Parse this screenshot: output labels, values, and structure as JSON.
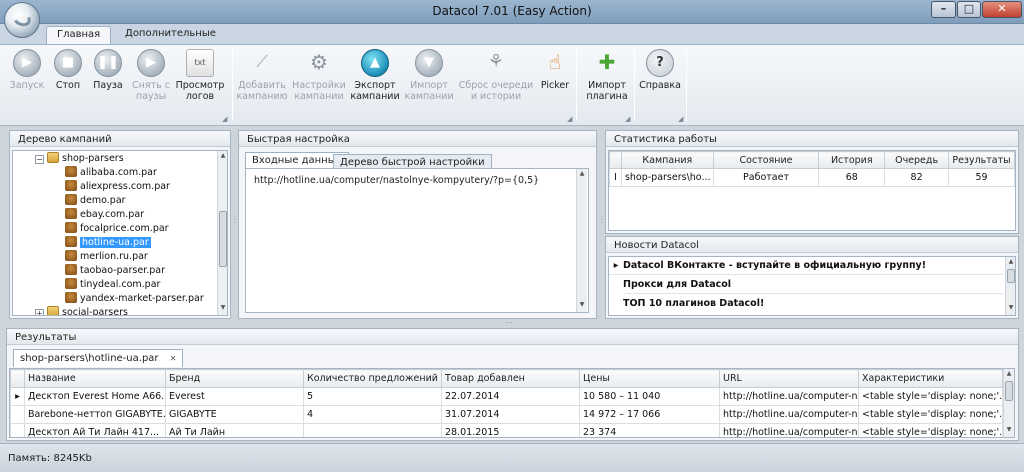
{
  "window": {
    "title": "Datacol 7.01 (Easy Action)",
    "min": "–",
    "max": "□",
    "close": "✕"
  },
  "ribbon": {
    "tabs": [
      "Главная",
      "Дополнительные"
    ],
    "buttons": {
      "start": [
        "Запуск",
        ""
      ],
      "stop": [
        "Стоп",
        ""
      ],
      "pause": [
        "Пауза",
        ""
      ],
      "unpause": [
        "Снять с",
        "паузы"
      ],
      "logs": [
        "Просмотр",
        "логов"
      ],
      "add_campaign": [
        "Добавить",
        "кампанию"
      ],
      "campaign_settings": [
        "Настройки",
        "кампании"
      ],
      "export_campaigns": [
        "Экспорт",
        "кампании"
      ],
      "import_campaigns": [
        "Импорт",
        "кампании"
      ],
      "reset_queue": [
        "Сброс очереди",
        "и истории"
      ],
      "picker": [
        "Picker",
        ""
      ],
      "import_plugin": [
        "Импорт",
        "плагина"
      ],
      "help": [
        "Справка",
        ""
      ]
    }
  },
  "tree_panel": {
    "title": "Дерево кампаний",
    "root": "shop-parsers",
    "items": [
      "alibaba.com.par",
      "aliexpress.com.par",
      "demo.par",
      "ebay.com.par",
      "focalprice.com.par",
      "hotline-ua.par",
      "merlion.ru.par",
      "taobao-parser.par",
      "tinydeal.com.par",
      "yandex-market-parser.par"
    ],
    "selected": "hotline-ua.par",
    "next_folder": "social-parsers",
    "expand_minus": "−",
    "expand_plus": "+"
  },
  "quick_settings": {
    "title": "Быстрая настройка",
    "tabs": [
      "Входные данные",
      "Дерево быстрой настройки"
    ],
    "input_value": "http://hotline.ua/computer/nastolnye-kompyutery/?p={0,5}"
  },
  "stats": {
    "title": "Статистика работы",
    "columns": [
      "Кампания",
      "Состояние",
      "История",
      "Очередь",
      "Результаты"
    ],
    "row": {
      "marker": "I",
      "campaign": "shop-parsers\\ho...",
      "state": "Работает",
      "history": "68",
      "queue": "82",
      "results": "59"
    }
  },
  "news": {
    "title": "Новости Datacol",
    "marker": "▸",
    "items": [
      "Datacol ВКонтакте - вступайте в официальную группу!",
      "Прокси для Datacol",
      "ТОП 10 плагинов Datacol!"
    ]
  },
  "results": {
    "title": "Результаты",
    "tab_label": "shop-parsers\\hotline-ua.par",
    "tab_close": "✕",
    "columns": [
      "Название",
      "Бренд",
      "Количество предложений",
      "Товар добавлен",
      "Цены",
      "URL",
      "Характеристики"
    ],
    "rows": [
      {
        "marker": "▸",
        "name": "Десктоп Everest Home A66...",
        "brand": "Everest",
        "offers": "5",
        "added": "22.07.2014",
        "prices": "10 580 – 11 040",
        "url": "http://hotline.ua/computer-n...",
        "specs": "<table style='display: none;'..."
      },
      {
        "marker": "",
        "name": "Barebone-неттоп GIGABYTE...",
        "brand": "GIGABYTE",
        "offers": "4",
        "added": "31.07.2014",
        "prices": "14 972 – 17 066",
        "url": "http://hotline.ua/computer-n...",
        "specs": "<table style='display: none;'..."
      },
      {
        "marker": "",
        "name": "Десктоп Ай Ти Лайн 417...",
        "brand": "Ай Ти Лайн",
        "offers": "",
        "added": "28.01.2015",
        "prices": "23 374",
        "url": "http://hotline.ua/computer-n...",
        "specs": "<table style='display: none;'..."
      }
    ]
  },
  "status": {
    "memory": "Память: 8245Kb"
  }
}
